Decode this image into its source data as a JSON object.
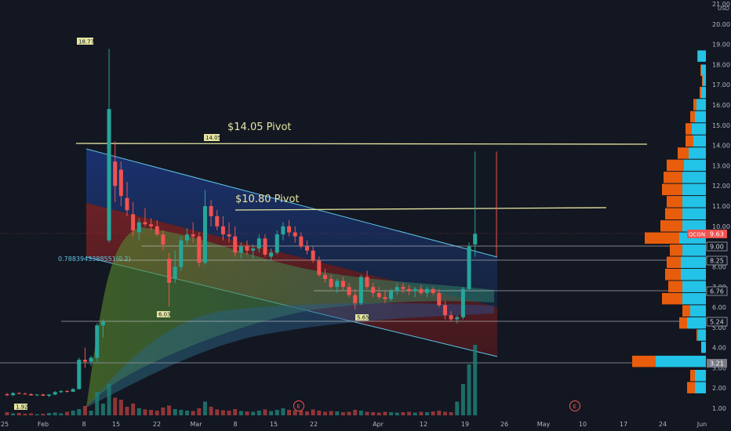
{
  "chart_data": {
    "type": "candlestick",
    "symbol": "QCGN",
    "currency": "USD",
    "last_price": "9.63",
    "y_axis_ticks": [
      "21.00",
      "20.00",
      "19.00",
      "18.00",
      "17.00",
      "16.00",
      "15.00",
      "14.00",
      "13.00",
      "12.00",
      "11.00",
      "10.00",
      "9.00",
      "8.00",
      "7.00",
      "6.00",
      "5.00",
      "4.00",
      "3.00",
      "2.00",
      "1.00"
    ],
    "y_unit_label": "USD",
    "x_axis_ticks": [
      "25",
      "Feb",
      "8",
      "15",
      "22",
      "Mar",
      "8",
      "15",
      "22",
      "Apr",
      "12",
      "19",
      "26",
      "May",
      "10",
      "17",
      "24",
      "Jun"
    ],
    "price_tags": [
      "9.00",
      "8.25",
      "6.76",
      "5.24",
      "3.21"
    ],
    "annotations": {
      "pivot_high": "$14.05 Pivot",
      "pivot_mid": "$10.80 Pivot",
      "fib_label": "0.7883943388551(0.2)",
      "high_marker": "18.77",
      "pivot_marker": "14.05",
      "low_marker_1": "6.03",
      "low_marker_2": "5.65",
      "low_marker_3": "1.92"
    },
    "earnings_markers": [
      "E",
      "E"
    ],
    "colors": {
      "up": "#26a69a",
      "down": "#ef5350",
      "volume_profile_up": "#22c3e6",
      "volume_profile_down": "#e85d0c",
      "pivot": "#e6e6a0"
    },
    "candles": [
      [
        1.7,
        1.75,
        1.6,
        1.65
      ],
      [
        1.65,
        1.8,
        1.6,
        1.75
      ],
      [
        1.75,
        1.8,
        1.7,
        1.72
      ],
      [
        1.72,
        1.78,
        1.68,
        1.7
      ],
      [
        1.7,
        1.74,
        1.62,
        1.64
      ],
      [
        1.64,
        1.7,
        1.6,
        1.68
      ],
      [
        1.68,
        1.72,
        1.6,
        1.62
      ],
      [
        1.62,
        1.7,
        1.55,
        1.68
      ],
      [
        1.68,
        1.85,
        1.65,
        1.8
      ],
      [
        1.8,
        1.9,
        1.75,
        1.85
      ],
      [
        1.85,
        1.9,
        1.78,
        1.82
      ],
      [
        1.82,
        2.0,
        1.8,
        1.95
      ],
      [
        1.95,
        3.5,
        1.92,
        3.4
      ],
      [
        3.4,
        4.0,
        3.0,
        3.3
      ],
      [
        3.3,
        3.6,
        3.1,
        3.5
      ],
      [
        3.5,
        5.2,
        3.3,
        5.1
      ],
      [
        5.1,
        5.4,
        4.5,
        5.3
      ],
      [
        9.3,
        18.77,
        9.2,
        15.8
      ],
      [
        13.2,
        14.2,
        11.2,
        12.0
      ],
      [
        12.8,
        13.2,
        11.0,
        11.5
      ],
      [
        11.4,
        12.2,
        10.5,
        10.8
      ],
      [
        10.6,
        11.2,
        9.5,
        9.8
      ],
      [
        9.7,
        10.4,
        9.3,
        10.2
      ],
      [
        10.2,
        10.9,
        10.0,
        10.1
      ],
      [
        10.1,
        10.4,
        9.8,
        10.0
      ],
      [
        10.0,
        10.3,
        9.5,
        9.6
      ],
      [
        9.6,
        9.8,
        8.8,
        9.1
      ],
      [
        8.4,
        8.7,
        6.03,
        7.2
      ],
      [
        7.4,
        8.8,
        7.2,
        8.0
      ],
      [
        8.0,
        9.5,
        7.8,
        9.3
      ],
      [
        9.3,
        9.9,
        9.0,
        9.6
      ],
      [
        9.6,
        10.2,
        9.2,
        9.5
      ],
      [
        9.5,
        9.7,
        8.0,
        8.2
      ],
      [
        8.2,
        11.8,
        8.1,
        11.0
      ],
      [
        11.0,
        11.3,
        10.0,
        10.5
      ],
      [
        10.5,
        10.8,
        9.8,
        10.0
      ],
      [
        10.0,
        10.5,
        9.3,
        9.6
      ],
      [
        9.6,
        10.2,
        9.2,
        9.5
      ],
      [
        9.5,
        10.0,
        8.5,
        8.7
      ],
      [
        8.7,
        9.2,
        8.4,
        9.0
      ],
      [
        9.0,
        9.3,
        8.6,
        8.8
      ],
      [
        8.8,
        9.1,
        8.4,
        8.9
      ],
      [
        8.9,
        9.6,
        8.7,
        9.4
      ],
      [
        9.4,
        9.6,
        8.5,
        8.6
      ],
      [
        8.5,
        8.9,
        8.3,
        8.7
      ],
      [
        8.7,
        9.8,
        8.6,
        9.6
      ],
      [
        9.6,
        10.2,
        9.3,
        10.0
      ],
      [
        10.0,
        10.3,
        9.5,
        9.7
      ],
      [
        9.7,
        10.0,
        9.2,
        9.5
      ],
      [
        9.5,
        9.7,
        8.9,
        9.0
      ],
      [
        9.0,
        9.3,
        8.6,
        8.8
      ],
      [
        8.8,
        9.0,
        8.2,
        8.3
      ],
      [
        8.3,
        8.5,
        7.5,
        7.6
      ],
      [
        7.6,
        7.9,
        7.2,
        7.4
      ],
      [
        7.4,
        7.6,
        6.9,
        7.0
      ],
      [
        7.0,
        7.4,
        6.7,
        7.3
      ],
      [
        7.3,
        7.5,
        6.8,
        7.0
      ],
      [
        7.0,
        7.2,
        6.5,
        6.6
      ],
      [
        6.6,
        6.9,
        5.9,
        6.2
      ],
      [
        6.2,
        7.6,
        6.1,
        7.5
      ],
      [
        7.5,
        7.8,
        6.9,
        7.0
      ],
      [
        7.0,
        7.2,
        6.5,
        6.7
      ],
      [
        6.7,
        7.0,
        6.4,
        6.5
      ],
      [
        6.5,
        6.8,
        6.2,
        6.4
      ],
      [
        6.4,
        6.9,
        6.3,
        6.8
      ],
      [
        6.8,
        7.2,
        6.6,
        7.0
      ],
      [
        7.0,
        7.2,
        6.7,
        6.9
      ],
      [
        6.9,
        7.1,
        6.6,
        6.8
      ],
      [
        6.8,
        7.0,
        6.5,
        6.9
      ],
      [
        6.9,
        7.1,
        6.6,
        6.7
      ],
      [
        6.7,
        7.0,
        6.5,
        6.9
      ],
      [
        6.9,
        7.0,
        6.6,
        6.7
      ],
      [
        6.7,
        6.9,
        6.0,
        6.1
      ],
      [
        6.1,
        6.3,
        5.4,
        5.6
      ],
      [
        5.6,
        5.8,
        5.3,
        5.4
      ],
      [
        5.4,
        5.6,
        5.2,
        5.5
      ],
      [
        5.5,
        7.0,
        5.4,
        6.9
      ],
      [
        6.9,
        9.2,
        6.8,
        9.0
      ],
      [
        9.1,
        13.7,
        8.5,
        9.63
      ]
    ],
    "volumes": [
      8,
      5,
      6,
      4,
      5,
      3,
      4,
      6,
      7,
      5,
      9,
      12,
      16,
      24,
      12,
      60,
      30,
      80,
      45,
      40,
      22,
      30,
      18,
      15,
      14,
      12,
      20,
      25,
      16,
      14,
      12,
      11,
      18,
      35,
      22,
      15,
      13,
      12,
      16,
      11,
      10,
      9,
      12,
      15,
      11,
      14,
      18,
      14,
      13,
      12,
      10,
      15,
      12,
      9,
      11,
      10,
      8,
      9,
      14,
      12,
      9,
      8,
      7,
      9,
      8,
      7,
      8,
      9,
      7,
      9,
      8,
      10,
      12,
      9,
      8,
      35,
      80,
      130,
      180
    ]
  }
}
